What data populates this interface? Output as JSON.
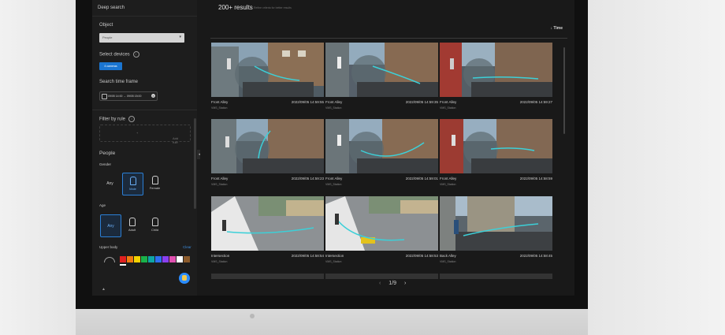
{
  "sidebar": {
    "title": "Deep search",
    "object_label": "Object",
    "object_value": "People",
    "devices_label": "Select devices",
    "devices_button": "4 cameras",
    "time_label": "Search time frame",
    "time_value": "09/05 14:00 → 09/05 15:00",
    "filter_label": "Filter by rule",
    "add_rule": "Add rule",
    "people_label": "People",
    "gender_label": "Gender",
    "gender_options": [
      "Any",
      "Male",
      "Female"
    ],
    "gender_selected": "Male",
    "age_label": "Age",
    "age_options": [
      "Any",
      "Adult",
      "Child"
    ],
    "age_selected": "Any",
    "upper_label": "Upper body",
    "clear_label": "Clear",
    "colors": [
      "#e02020",
      "#f07a10",
      "#f3d200",
      "#19b24a",
      "#0ea5a5",
      "#2f6ff0",
      "#8a3ff0",
      "#e050b0",
      "#ffffff",
      "#8b5a2b"
    ]
  },
  "main": {
    "results_count": "200+ results",
    "results_hint": "Refine criteria for better results",
    "sort_label": "Time",
    "pagination": {
      "prev": "‹",
      "current": "1/9",
      "next": "›"
    },
    "results": [
      {
        "location": "Front Alley",
        "time": "2022/09/05 14:59:55",
        "device": "VMS_Station"
      },
      {
        "location": "Front Alley",
        "time": "2022/09/05 14:59:35",
        "device": "VMS_Station"
      },
      {
        "location": "Front Alley",
        "time": "2022/09/05 14:59:27",
        "device": "VMS_Station"
      },
      {
        "location": "Front Alley",
        "time": "2022/09/05 14:59:23",
        "device": "VMS_Station"
      },
      {
        "location": "Front Alley",
        "time": "2022/09/05 14:59:01",
        "device": "VMS_Station"
      },
      {
        "location": "Front Alley",
        "time": "2022/09/05 14:58:59",
        "device": "VMS_Station"
      },
      {
        "location": "Intersection",
        "time": "2022/09/05 14:58:54",
        "device": "VMS_Station"
      },
      {
        "location": "Intersection",
        "time": "2022/09/05 14:58:53",
        "device": "VMS_Station"
      },
      {
        "location": "Back Alley",
        "time": "2022/09/05 14:58:45",
        "device": "VMS_Station"
      }
    ]
  }
}
